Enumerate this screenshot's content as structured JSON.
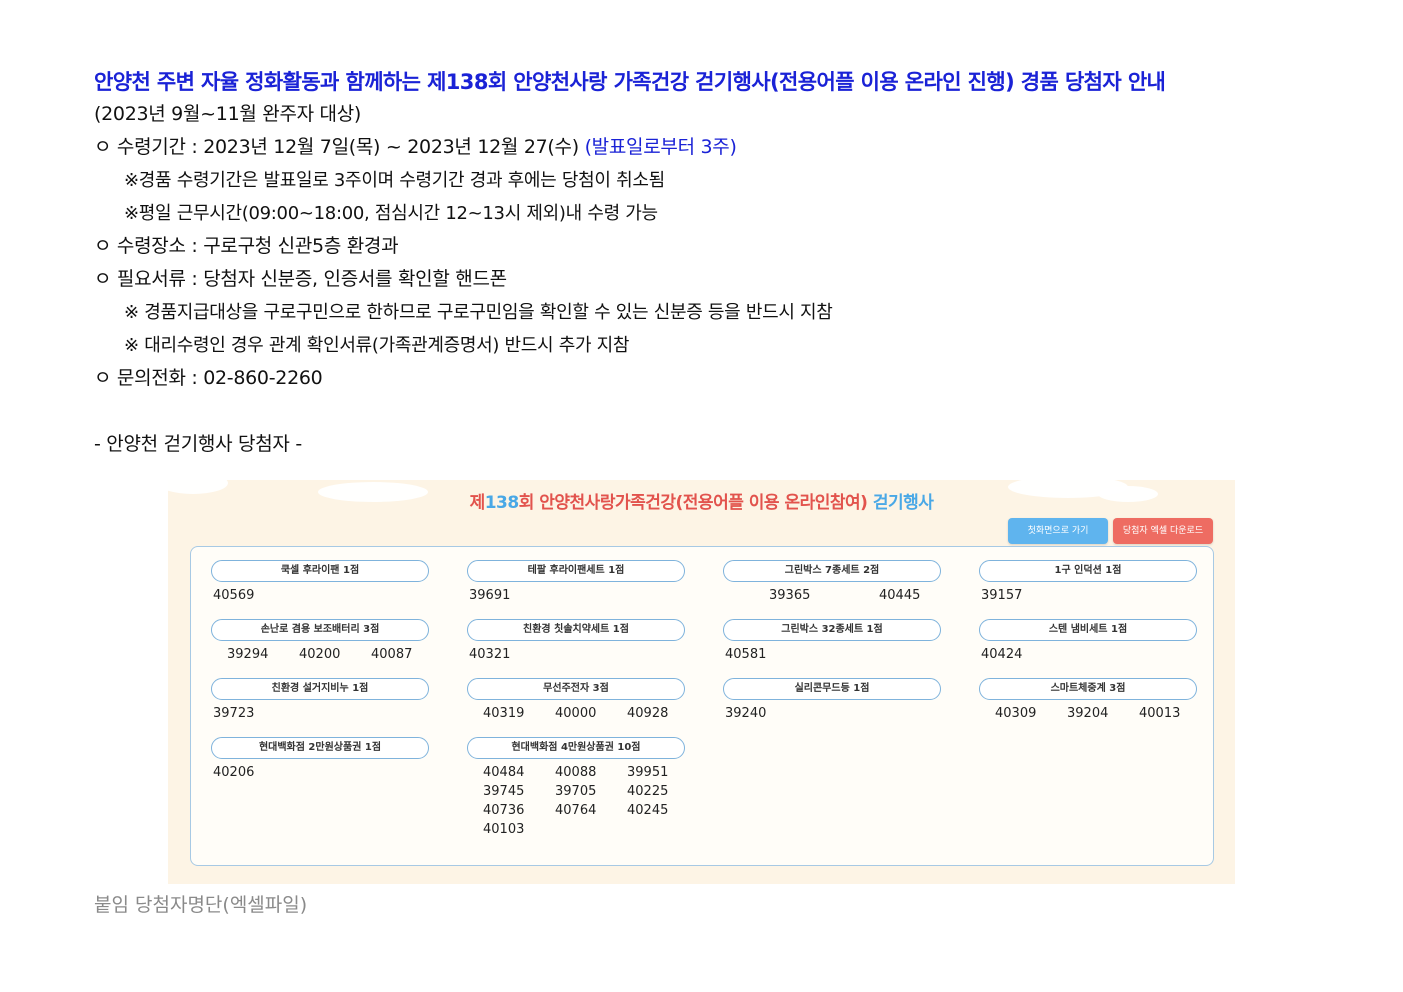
{
  "doc": {
    "title": "안양천 주변 자율 정화활동과 함께하는 제138회 안양천사랑 가족건강 걷기행사(전용어플 이용 온라인 진행) 경품 당첨자 안내",
    "target": "(2023년 9월~11월 완주자 대상)",
    "period": "ㅇ 수령기간 : 2023년 12월 7일(목) ~ 2023년 12월 27(수) ",
    "period_note": "(발표일로부터 3주)",
    "note1": "※경품 수령기간은 발표일로 3주이며 수령기간 경과 후에는 당첨이 취소됨",
    "note2": "※평일 근무시간(09:00~18:00, 점심시간 12~13시 제외)내 수령 가능",
    "place": "ㅇ 수령장소 : 구로구청 신관5층 환경과",
    "docs": "ㅇ 필요서류 : 당첨자 신분증, 인증서를 확인할 핸드폰",
    "docs_note1": "※ 경품지급대상을 구로구민으로 한하므로 구로구민임을 확인할 수 있는 신분증 등을 반드시 지참",
    "docs_note2": "※ 대리수령인 경우 관계 확인서류(가족관계증명서) 반드시 추가 지참",
    "phone": "ㅇ 문의전화 : 02-860-2260",
    "section": "- 안양천 걷기행사 당첨자 -",
    "attach": "붙임 당첨자명단(엑셀파일)"
  },
  "panel": {
    "title_a": "제",
    "title_num": "138",
    "title_b": "회 안양천사랑가족건강(전용어플 이용 온라인참여) ",
    "title_tail": "걷기행사",
    "btn_main": "첫화면으로 가기",
    "btn_excel": "당첨자 엑셀 다운로드",
    "prizes": [
      {
        "name": "쿡셀 후라이팬 1점",
        "winners": [
          "40569"
        ]
      },
      {
        "name": "테팔 후라이팬세트 1점",
        "winners": [
          "39691"
        ]
      },
      {
        "name": "그린박스 7종세트 2점",
        "winners": [
          "39365",
          "40445"
        ]
      },
      {
        "name": "1구 인덕션 1점",
        "winners": [
          "39157"
        ]
      },
      {
        "name": "손난로 겸용 보조배터리 3점",
        "winners": [
          "39294",
          "40200",
          "40087"
        ]
      },
      {
        "name": "친환경 칫솔치약세트 1점",
        "winners": [
          "40321"
        ]
      },
      {
        "name": "그린박스 32종세트 1점",
        "winners": [
          "40581"
        ]
      },
      {
        "name": "스텐 냄비세트 1점",
        "winners": [
          "40424"
        ]
      },
      {
        "name": "친환경 설거지비누 1점",
        "winners": [
          "39723"
        ]
      },
      {
        "name": "무선주전자 3점",
        "winners": [
          "40319",
          "40000",
          "40928"
        ]
      },
      {
        "name": "실리콘무드등 1점",
        "winners": [
          "39240"
        ]
      },
      {
        "name": "스마트체중계 3점",
        "winners": [
          "40309",
          "39204",
          "40013"
        ]
      },
      {
        "name": "현대백화점 2만원상품권 1점",
        "winners": [
          "40206"
        ]
      },
      {
        "name": "현대백화점 4만원상품권 10점",
        "winners": [
          "40484",
          "40088",
          "39951",
          "39745",
          "39705",
          "40225",
          "40736",
          "40764",
          "40245",
          "40103"
        ]
      }
    ]
  }
}
